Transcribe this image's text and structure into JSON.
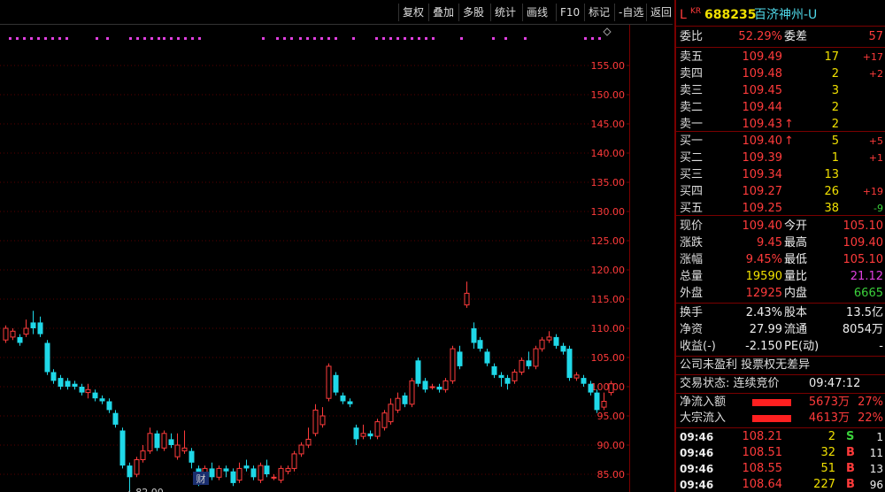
{
  "toolbar": {
    "buttons": [
      "复权",
      "叠加",
      "多股",
      "统计",
      "画线",
      "F10",
      "标记",
      "-自选",
      "返回"
    ]
  },
  "header": {
    "l_mark": "L",
    "kr_mark": "KR",
    "code": "688235",
    "name": "百济神州-U"
  },
  "quote": {
    "weibi_label": "委比",
    "weibi": "52.29%",
    "weicha_label": "委差",
    "weicha": "57",
    "sells": [
      {
        "label": "卖五",
        "price": "109.49",
        "vol": "17",
        "chg": "+17",
        "arrow": ""
      },
      {
        "label": "卖四",
        "price": "109.48",
        "vol": "2",
        "chg": "+2",
        "arrow": ""
      },
      {
        "label": "卖三",
        "price": "109.45",
        "vol": "3",
        "chg": "",
        "arrow": ""
      },
      {
        "label": "卖二",
        "price": "109.44",
        "vol": "2",
        "chg": "",
        "arrow": ""
      },
      {
        "label": "卖一",
        "price": "109.43",
        "vol": "2",
        "chg": "",
        "arrow": "↑"
      }
    ],
    "buys": [
      {
        "label": "买一",
        "price": "109.40",
        "vol": "5",
        "chg": "+5",
        "arrow": "↑"
      },
      {
        "label": "买二",
        "price": "109.39",
        "vol": "1",
        "chg": "+1",
        "arrow": ""
      },
      {
        "label": "买三",
        "price": "109.34",
        "vol": "13",
        "chg": "",
        "arrow": ""
      },
      {
        "label": "买四",
        "price": "109.27",
        "vol": "26",
        "chg": "+19",
        "arrow": ""
      },
      {
        "label": "买五",
        "price": "109.25",
        "vol": "38",
        "chg": "-9",
        "arrow": ""
      }
    ],
    "xianjia_label": "现价",
    "xianjia": "109.40",
    "jinkai_label": "今开",
    "jinkai": "105.10",
    "zhangdie_label": "涨跌",
    "zhangdie": "9.45",
    "zuigao_label": "最高",
    "zuigao": "109.40",
    "zhangfu_label": "涨幅",
    "zhangfu": "9.45%",
    "zuidi_label": "最低",
    "zuidi": "105.10",
    "zongliang_label": "总量",
    "zongliang": "19590",
    "liangbi_label": "量比",
    "liangbi": "21.12",
    "waipan_label": "外盘",
    "waipan": "12925",
    "neipan_label": "内盘",
    "neipan": "6665",
    "huanshou_label": "换手",
    "huanshou": "2.43%",
    "guben_label": "股本",
    "guben": "13.5亿",
    "jingzi_label": "净资",
    "jingzi": "27.99",
    "liutong_label": "流通",
    "liutong": "8054万",
    "shouyi_label": "收益(-)",
    "shouyi": "-2.150",
    "pe_label": "PE(动)",
    "pe": "-",
    "note": "公司未盈利 投票权无差异",
    "status_label": "交易状态: 连续竞价",
    "status_time": "09:47:12",
    "inflow_label": "净流入额",
    "inflow": "5673万",
    "inflow_pct": "27%",
    "block_label": "大宗流入",
    "block": "4613万",
    "block_pct": "22%"
  },
  "ticks": [
    {
      "time": "09:46",
      "price": "108.21",
      "vol": "2",
      "side": "S",
      "n": "1"
    },
    {
      "time": "09:46",
      "price": "108.51",
      "vol": "32",
      "side": "B",
      "n": "11"
    },
    {
      "time": "09:46",
      "price": "108.55",
      "vol": "51",
      "side": "B",
      "n": "13"
    },
    {
      "time": "09:46",
      "price": "108.64",
      "vol": "227",
      "side": "B",
      "n": "96"
    }
  ],
  "chart_data": {
    "type": "candlestick",
    "y_ticks": [
      "155.00",
      "150.00",
      "145.00",
      "140.00",
      "135.00",
      "130.00",
      "125.00",
      "120.00",
      "115.00",
      "110.00",
      "105.00",
      "100.00",
      "95.00",
      "90.00",
      "85.00"
    ],
    "y_tick_values": [
      155,
      150,
      145,
      140,
      135,
      130,
      125,
      120,
      115,
      110,
      105,
      100,
      95,
      90,
      85
    ],
    "ylim": [
      80,
      160
    ],
    "low_marker": "←82.00",
    "low_marker_value": 82.0,
    "event_marker": "财",
    "colors": {
      "up": "#ff3b3b",
      "down": "#1fd8e8",
      "grid": "#5a0000",
      "axis": "#7a0000",
      "label": "#ff3b3b"
    },
    "candles": [
      {
        "o": 108,
        "c": 110,
        "h": 110.5,
        "l": 107.5
      },
      {
        "o": 108.5,
        "c": 109.5,
        "h": 110,
        "l": 108
      },
      {
        "o": 108.5,
        "c": 107.5,
        "h": 109,
        "l": 107
      },
      {
        "o": 109,
        "c": 110,
        "h": 111.5,
        "l": 108.5
      },
      {
        "o": 111,
        "c": 110,
        "h": 113,
        "l": 109
      },
      {
        "o": 111,
        "c": 109,
        "h": 112,
        "l": 108.5
      },
      {
        "o": 107.5,
        "c": 102.5,
        "h": 108,
        "l": 102
      },
      {
        "o": 102.5,
        "c": 101,
        "h": 103,
        "l": 100.5
      },
      {
        "o": 101.5,
        "c": 100,
        "h": 102,
        "l": 99.5
      },
      {
        "o": 101,
        "c": 100,
        "h": 101.5,
        "l": 99.5
      },
      {
        "o": 100.5,
        "c": 100,
        "h": 101,
        "l": 99.5
      },
      {
        "o": 100,
        "c": 99,
        "h": 100.5,
        "l": 98.5
      },
      {
        "o": 99,
        "c": 99.5,
        "h": 100.5,
        "l": 98
      },
      {
        "o": 99,
        "c": 98,
        "h": 99.5,
        "l": 97.5
      },
      {
        "o": 98,
        "c": 97.5,
        "h": 98.5,
        "l": 97
      },
      {
        "o": 97.5,
        "c": 96,
        "h": 98,
        "l": 95.5
      },
      {
        "o": 95.5,
        "c": 93.5,
        "h": 96,
        "l": 93
      },
      {
        "o": 92.5,
        "c": 86.5,
        "h": 93,
        "l": 86
      },
      {
        "o": 86.5,
        "c": 84.5,
        "h": 87,
        "l": 82
      },
      {
        "o": 85,
        "c": 87.5,
        "h": 88,
        "l": 84.5
      },
      {
        "o": 87.5,
        "c": 89,
        "h": 90,
        "l": 87
      },
      {
        "o": 89,
        "c": 92,
        "h": 93,
        "l": 88.5
      },
      {
        "o": 92,
        "c": 89.5,
        "h": 92.5,
        "l": 89
      },
      {
        "o": 89.5,
        "c": 92,
        "h": 92.5,
        "l": 89
      },
      {
        "o": 91,
        "c": 90,
        "h": 92,
        "l": 89.5
      },
      {
        "o": 88,
        "c": 90,
        "h": 92,
        "l": 87.5
      },
      {
        "o": 89,
        "c": 89.5,
        "h": 92.5,
        "l": 88.5
      },
      {
        "o": 89,
        "c": 87,
        "h": 89.5,
        "l": 86
      },
      {
        "o": 86,
        "c": 83.5,
        "h": 86.5,
        "l": 83
      },
      {
        "o": 84,
        "c": 86,
        "h": 86.5,
        "l": 83.5
      },
      {
        "o": 86,
        "c": 84.5,
        "h": 87,
        "l": 84
      },
      {
        "o": 84.5,
        "c": 86,
        "h": 86.5,
        "l": 84
      },
      {
        "o": 86,
        "c": 85.5,
        "h": 86.5,
        "l": 84.5
      },
      {
        "o": 85.5,
        "c": 83.5,
        "h": 86,
        "l": 83
      },
      {
        "o": 84,
        "c": 86,
        "h": 87,
        "l": 83.5
      },
      {
        "o": 86.5,
        "c": 86,
        "h": 87.5,
        "l": 85.5
      },
      {
        "o": 86,
        "c": 84.5,
        "h": 86.5,
        "l": 84
      },
      {
        "o": 84,
        "c": 86.5,
        "h": 87,
        "l": 83.5
      },
      {
        "o": 86.5,
        "c": 85,
        "h": 87.5,
        "l": 84.5
      },
      {
        "o": 84.5,
        "c": 84.5,
        "h": 85,
        "l": 84
      },
      {
        "o": 84,
        "c": 86,
        "h": 86.5,
        "l": 83.5
      },
      {
        "o": 85.5,
        "c": 86,
        "h": 86.5,
        "l": 85
      },
      {
        "o": 86,
        "c": 88.5,
        "h": 89,
        "l": 85.5
      },
      {
        "o": 88.5,
        "c": 90,
        "h": 90.5,
        "l": 88
      },
      {
        "o": 90,
        "c": 91,
        "h": 93,
        "l": 89.5
      },
      {
        "o": 92,
        "c": 96,
        "h": 97,
        "l": 91.5
      },
      {
        "o": 93.5,
        "c": 95,
        "h": 96.5,
        "l": 93
      },
      {
        "o": 98,
        "c": 103.5,
        "h": 104,
        "l": 97.5
      },
      {
        "o": 102,
        "c": 99,
        "h": 102.5,
        "l": 98.5
      },
      {
        "o": 98.5,
        "c": 97.5,
        "h": 99,
        "l": 97
      },
      {
        "o": 97.5,
        "c": 97,
        "h": 98,
        "l": 96.5
      },
      {
        "o": 93,
        "c": 91,
        "h": 93.5,
        "l": 90
      },
      {
        "o": 91.5,
        "c": 92,
        "h": 93.5,
        "l": 91
      },
      {
        "o": 92,
        "c": 91.5,
        "h": 92.5,
        "l": 91
      },
      {
        "o": 91.5,
        "c": 94,
        "h": 94.5,
        "l": 91
      },
      {
        "o": 93,
        "c": 95.5,
        "h": 96,
        "l": 92.5
      },
      {
        "o": 94,
        "c": 97,
        "h": 98,
        "l": 93.5
      },
      {
        "o": 96,
        "c": 98,
        "h": 99,
        "l": 95.5
      },
      {
        "o": 98.5,
        "c": 97,
        "h": 99,
        "l": 96.5
      },
      {
        "o": 97,
        "c": 101,
        "h": 101.5,
        "l": 96.5
      },
      {
        "o": 104.5,
        "c": 100.5,
        "h": 105,
        "l": 100
      },
      {
        "o": 101,
        "c": 99.5,
        "h": 101.5,
        "l": 99
      },
      {
        "o": 100,
        "c": 100,
        "h": 100.5,
        "l": 99.5
      },
      {
        "o": 100,
        "c": 99.5,
        "h": 100.5,
        "l": 99
      },
      {
        "o": 99.5,
        "c": 101,
        "h": 101.5,
        "l": 99
      },
      {
        "o": 101,
        "c": 106.5,
        "h": 107,
        "l": 100.5
      },
      {
        "o": 106,
        "c": 103.5,
        "h": 107,
        "l": 103
      },
      {
        "o": 114,
        "c": 116,
        "h": 118,
        "l": 113.5
      },
      {
        "o": 110,
        "c": 107.5,
        "h": 111,
        "l": 106.5
      },
      {
        "o": 108,
        "c": 106.5,
        "h": 108.5,
        "l": 106
      },
      {
        "o": 106,
        "c": 104,
        "h": 106.5,
        "l": 103.5
      },
      {
        "o": 103.5,
        "c": 102,
        "h": 104,
        "l": 101.5
      },
      {
        "o": 102,
        "c": 101.5,
        "h": 102.5,
        "l": 100
      },
      {
        "o": 101.5,
        "c": 100.5,
        "h": 102,
        "l": 99.5
      },
      {
        "o": 101,
        "c": 102.5,
        "h": 103,
        "l": 100.5
      },
      {
        "o": 102.5,
        "c": 104.5,
        "h": 105,
        "l": 102
      },
      {
        "o": 104.5,
        "c": 103.5,
        "h": 106,
        "l": 103
      },
      {
        "o": 103.5,
        "c": 106.5,
        "h": 107,
        "l": 103
      },
      {
        "o": 106.5,
        "c": 108,
        "h": 108.5,
        "l": 106
      },
      {
        "o": 108,
        "c": 108.5,
        "h": 109.5,
        "l": 107.5
      },
      {
        "o": 108.5,
        "c": 107,
        "h": 109,
        "l": 106.5
      },
      {
        "o": 107,
        "c": 106,
        "h": 107.5,
        "l": 105.5
      },
      {
        "o": 106.5,
        "c": 101.5,
        "h": 107,
        "l": 101
      },
      {
        "o": 101.5,
        "c": 102,
        "h": 102.5,
        "l": 101
      },
      {
        "o": 101.5,
        "c": 100.5,
        "h": 102,
        "l": 100
      },
      {
        "o": 100.5,
        "c": 99,
        "h": 101,
        "l": 98.5
      },
      {
        "o": 99,
        "c": 96,
        "h": 99.5,
        "l": 95.5
      },
      {
        "o": 96.5,
        "c": 97.5,
        "h": 99,
        "l": 96
      },
      {
        "o": 99,
        "c": 100.5,
        "h": 101,
        "l": 98.5
      }
    ]
  }
}
